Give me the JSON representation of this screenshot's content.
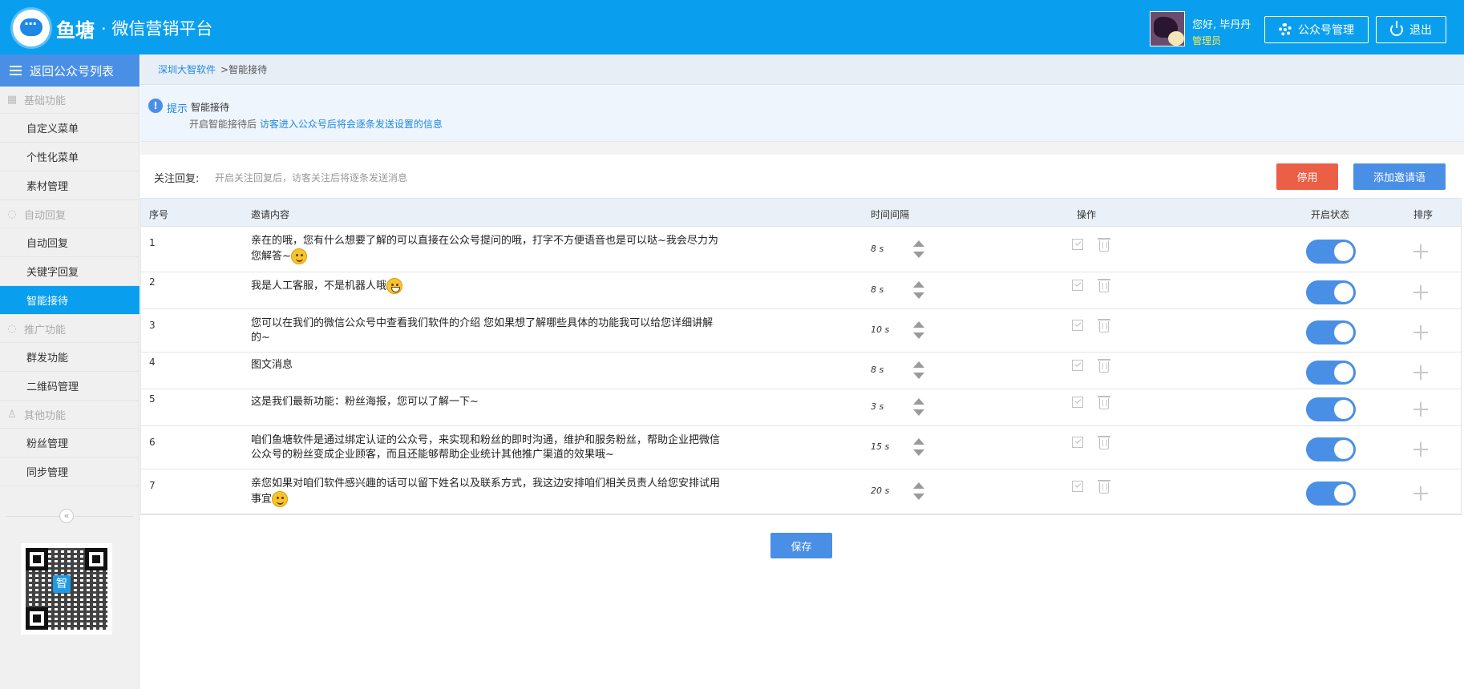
{
  "header": {
    "brand": "鱼塘",
    "subtitle": "· 微信营销平台",
    "greeting": "您好, 毕丹丹",
    "role": "管理员",
    "account_button": "公众号管理",
    "logout_button": "退出"
  },
  "sidebar": {
    "back": "返回公众号列表",
    "groups": [
      {
        "label": "基础功能",
        "icon": "grid-icon"
      },
      {
        "label": "自动回复",
        "icon": "chat-icon"
      },
      {
        "label": "推广功能",
        "icon": "chat-icon"
      },
      {
        "label": "其他功能",
        "icon": "thumb-icon"
      }
    ],
    "items": [
      "自定义菜单",
      "个性化菜单",
      "素材管理",
      "自动回复",
      "关键字回复",
      "智能接待",
      "群发功能",
      "二维码管理",
      "粉丝管理",
      "同步管理"
    ],
    "active": "智能接待",
    "collapse": "«",
    "qr_badge": "智"
  },
  "breadcrumb": {
    "root": "深圳大智软件",
    "current": ">智能接待"
  },
  "tip": {
    "label": "提示",
    "title": "智能接待",
    "text_prefix": "开启智能接待后",
    "text_link": "访客进入公众号后将会逐条发送设置的信息"
  },
  "follow": {
    "label": "关注回复:",
    "description": "开启关注回复后，访客关注后将逐条发送消息",
    "disable_button": "停用",
    "add_button": "添加邀请语"
  },
  "table": {
    "headers": [
      "序号",
      "邀请内容",
      "时间间隔",
      "操作",
      "开启状态",
      "排序"
    ],
    "rows": [
      {
        "no": "1",
        "line1": "亲在的哦，您有什么想要了解的可以直接在公众号提问的哦，打字不方便语音也是可以哒~我会尽力为",
        "line2": "您解答~",
        "emoji": "smile",
        "time": "8  s",
        "enabled": true
      },
      {
        "no": "2",
        "line1": "我是人工客服，不是机器人哦",
        "line2": "",
        "emoji": "grin",
        "time": "8  s",
        "enabled": true
      },
      {
        "no": "3",
        "line1": "您可以在我们的微信公众号中查看我们软件的介绍 您如果想了解哪些具体的功能我可以给您详细讲解",
        "line2": "的~",
        "emoji": "",
        "time": "10 s",
        "enabled": true
      },
      {
        "no": "4",
        "line1": "图文消息",
        "line2": "",
        "emoji": "",
        "time": "8  s",
        "enabled": true
      },
      {
        "no": "5",
        "line1": "这是我们最新功能：粉丝海报，您可以了解一下~",
        "line2": "",
        "emoji": "",
        "time": "3  s",
        "enabled": true
      },
      {
        "no": "6",
        "line1": "咱们鱼塘软件是通过绑定认证的公众号，来实现和粉丝的即时沟通，维护和服务粉丝，帮助企业把微信",
        "line2": "公众号的粉丝变成企业顾客，而且还能够帮助企业统计其他推广渠道的效果哦~",
        "emoji": "",
        "time": "15 s",
        "enabled": true
      },
      {
        "no": "7",
        "line1": "亲您如果对咱们软件感兴趣的话可以留下姓名以及联系方式，我这边安排咱们相关员责人给您安排试用",
        "line2": "事宜",
        "emoji": "smile",
        "time": "20 s",
        "enabled": true
      }
    ]
  },
  "save_button": "保存",
  "colors": {
    "header": "#0a9fee",
    "accent": "#4a8fe6",
    "danger": "#ec5f47"
  }
}
